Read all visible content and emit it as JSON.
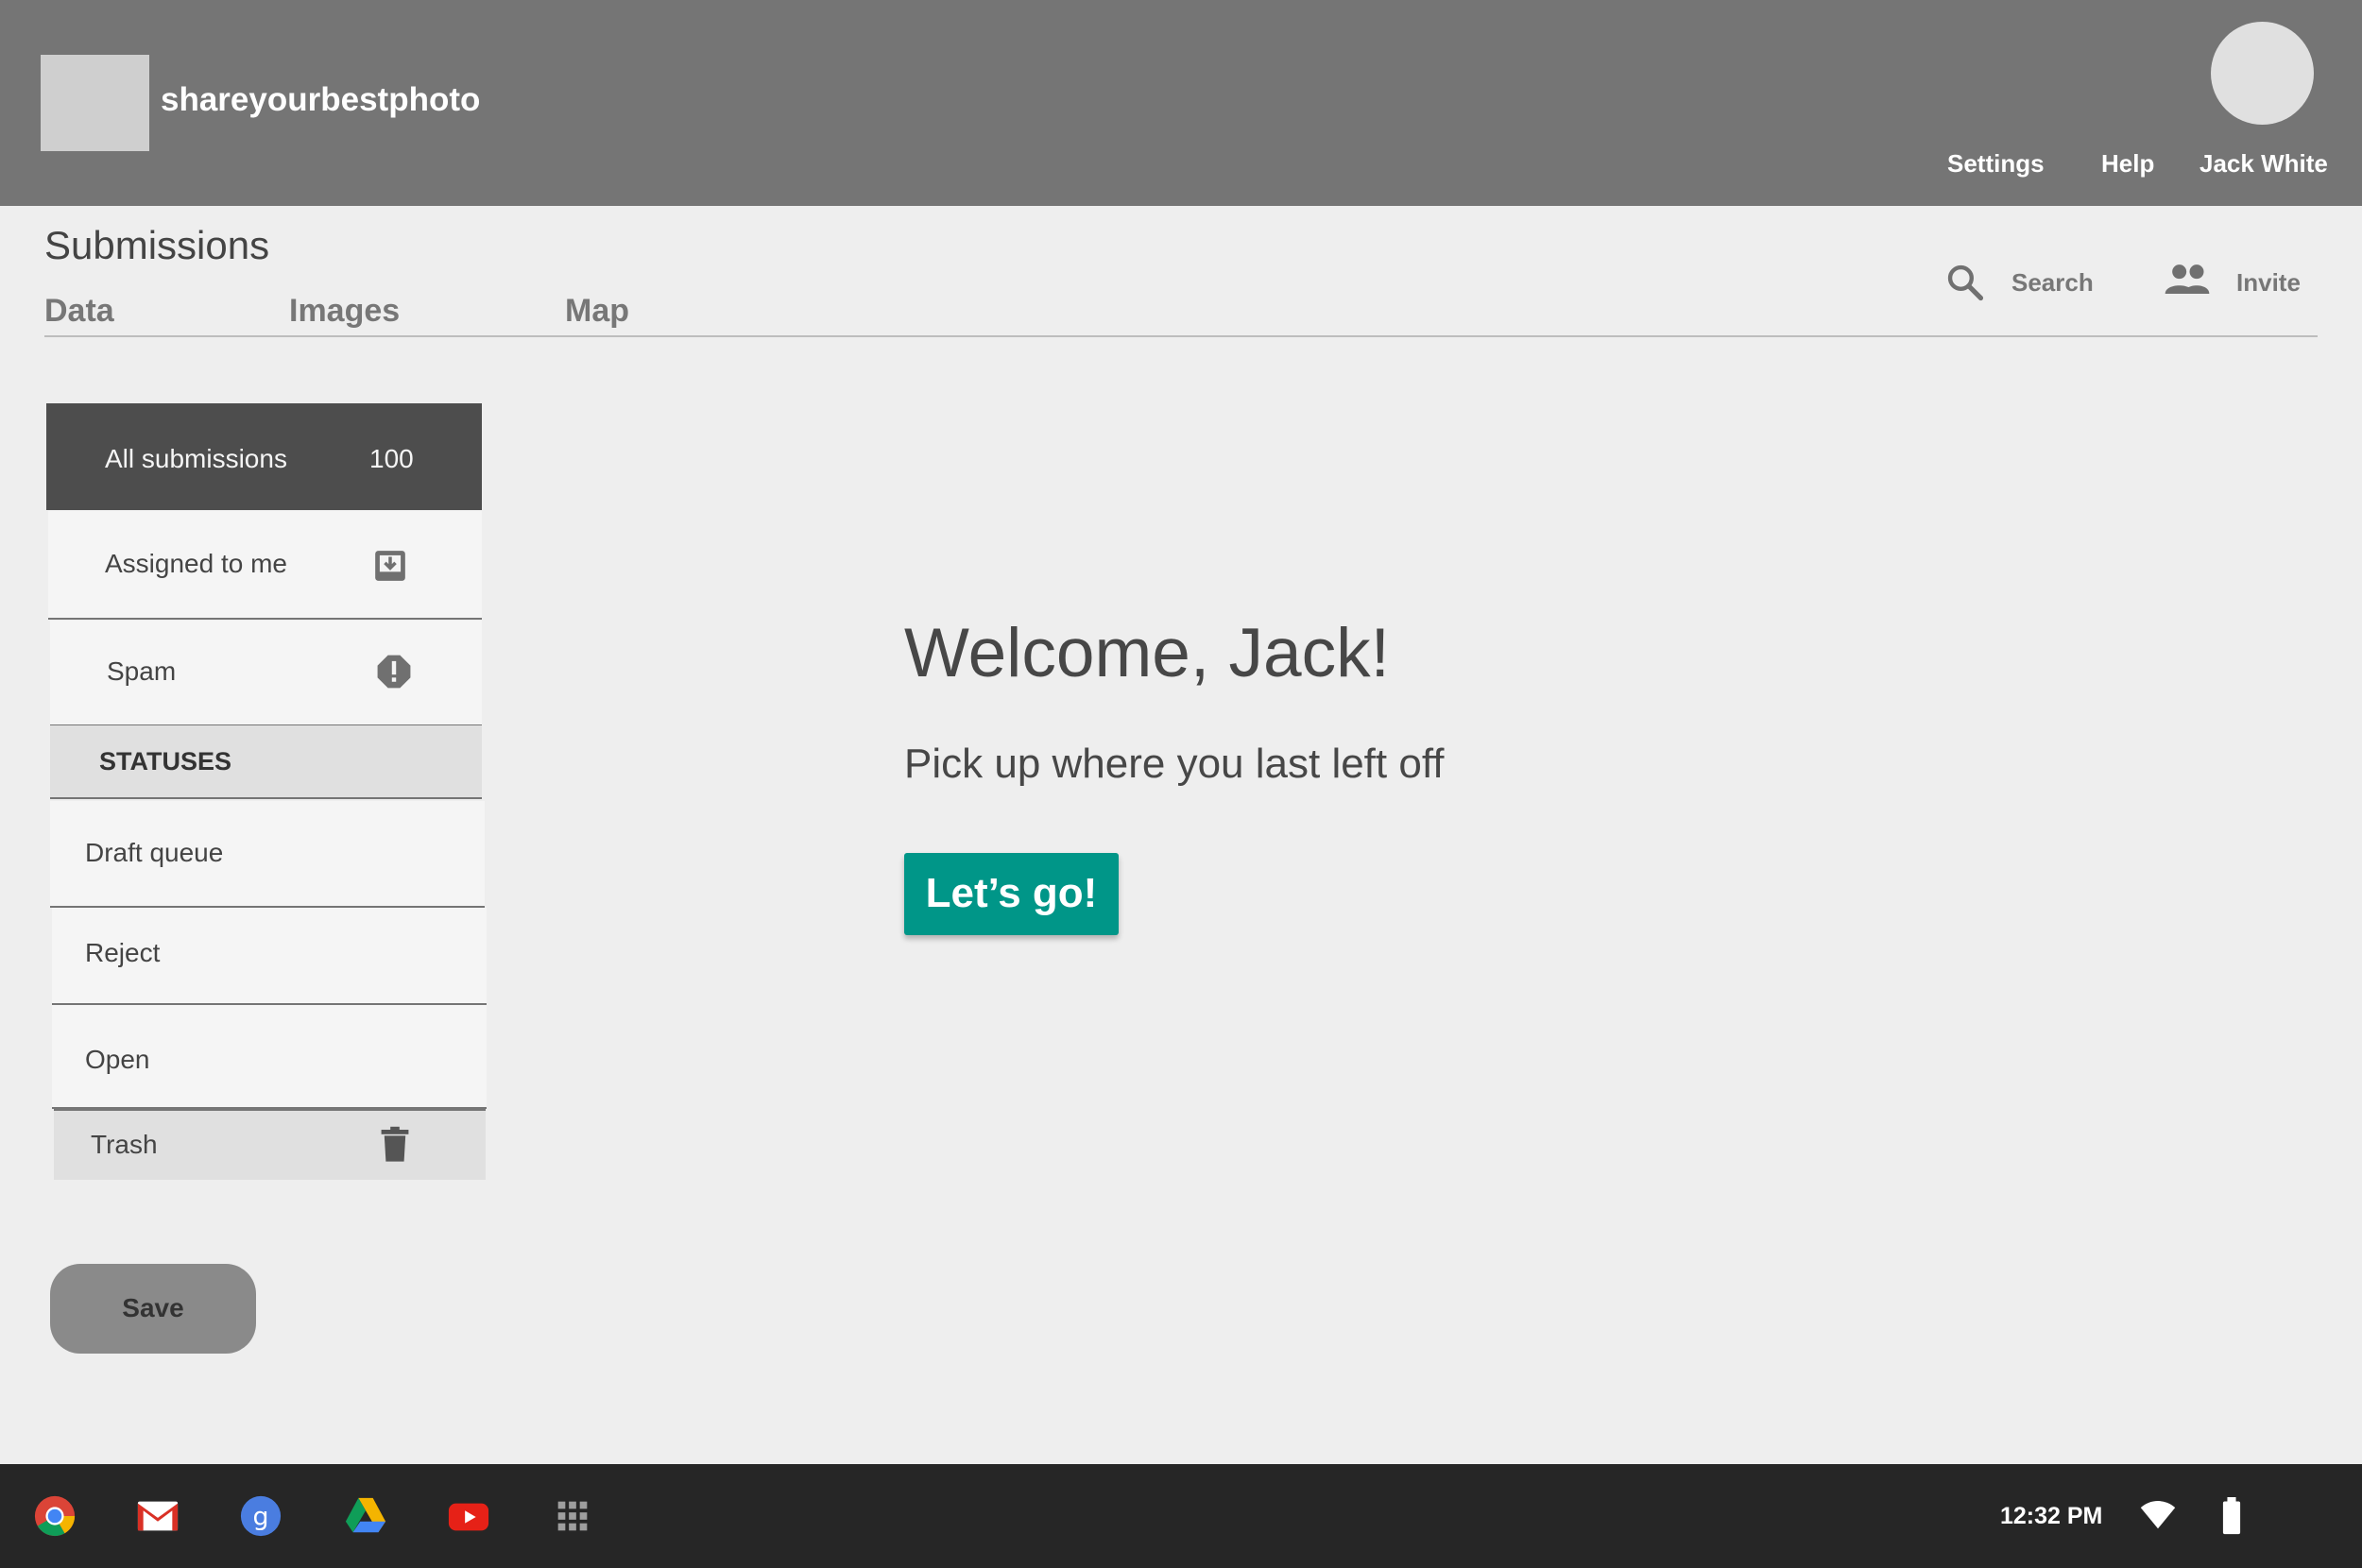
{
  "header": {
    "brand": "shareyourbestphoto",
    "nav": {
      "settings": "Settings",
      "help": "Help",
      "user": "Jack White"
    }
  },
  "page": {
    "title": "Submissions",
    "tabs": [
      "Data",
      "Images",
      "Map"
    ],
    "actions": {
      "search": "Search",
      "invite": "Invite"
    }
  },
  "sidebar": {
    "all": {
      "label": "All submissions",
      "count": "100"
    },
    "assigned": {
      "label": "Assigned to me",
      "icon": "inbox-download-icon"
    },
    "spam": {
      "label": "Spam",
      "icon": "alert-octagon-icon"
    },
    "statuses_header": "STATUSES",
    "statuses": [
      "Draft queue",
      "Reject",
      "Open"
    ],
    "trash": {
      "label": "Trash",
      "icon": "trash-icon"
    },
    "save": "Save"
  },
  "welcome": {
    "title": "Welcome, Jack!",
    "subtitle": "Pick up where you last left off",
    "cta": "Let’s go!"
  },
  "taskbar": {
    "apps": [
      "chrome-icon",
      "gmail-icon",
      "google-plus-icon",
      "drive-icon",
      "youtube-icon",
      "app-launcher-icon"
    ],
    "time": "12:32 PM",
    "status_icons": [
      "wifi-icon",
      "battery-icon"
    ]
  },
  "colors": {
    "header_bg": "#757575",
    "accent": "#009688",
    "selected_item_bg": "#4d4d4d",
    "taskbar_bg": "#262626"
  }
}
